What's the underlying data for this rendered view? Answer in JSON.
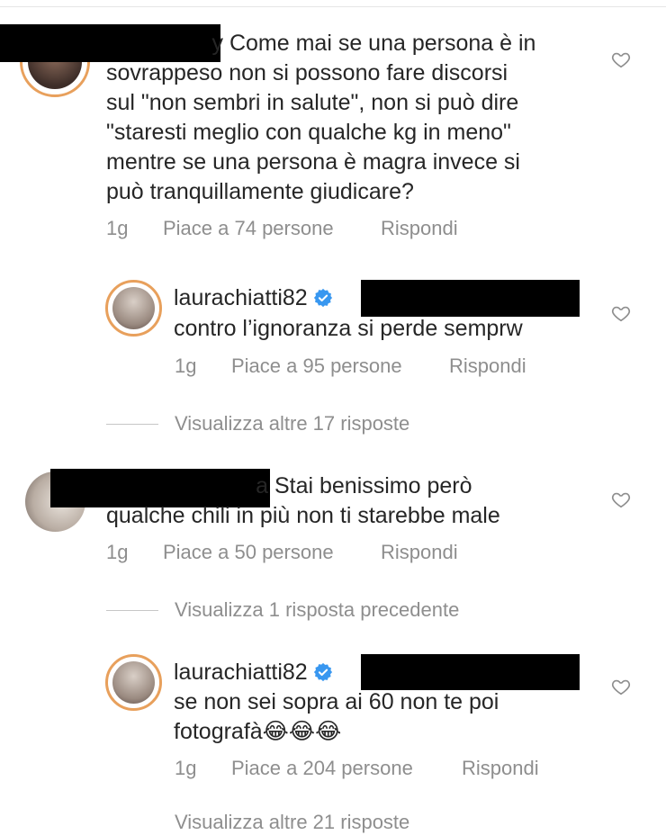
{
  "comments": [
    {
      "username_visible_suffix": "y",
      "text_lines": [
        "Come mai se una persona è in",
        "sovrappeso non si possono fare discorsi",
        "sul \"non sembri in salute\", non si può dire",
        "\"staresti meglio con qualche kg in meno\"",
        "mentre se una persona è magra invece si",
        "può tranquillamente giudicare?"
      ],
      "time": "1g",
      "likes": "Piace a 74 persone",
      "reply": "Rispondi"
    },
    {
      "username": "laurachiatti82",
      "text_lines": [
        "contro l’ignoranza si perde semprw"
      ],
      "time": "1g",
      "likes": "Piace a 95 persone",
      "reply": "Rispondi"
    },
    {
      "username_visible_suffix": "a",
      "text_lines": [
        "Stai benissimo però",
        "qualche chili in più non ti starebbe male"
      ],
      "time": "1g",
      "likes": "Piace a 50 persone",
      "reply": "Rispondi"
    },
    {
      "username": "laurachiatti82",
      "text_lines": [
        "se non sei sopra ai 60 non te poi",
        "fotografà😂😂😂"
      ],
      "time": "1g",
      "likes": "Piace a 204 persone",
      "reply": "Rispondi"
    }
  ],
  "view_more_replies": "Visualizza altre 17 risposte",
  "view_previous_reply": "Visualizza 1 risposta precedente",
  "bottom_cut_text": "Visualizza altre 21 risposte",
  "colors": {
    "text": "#262626",
    "meta": "#8e8e8e",
    "verified": "#3897f0",
    "avatar_ring": "#e8a05c"
  }
}
